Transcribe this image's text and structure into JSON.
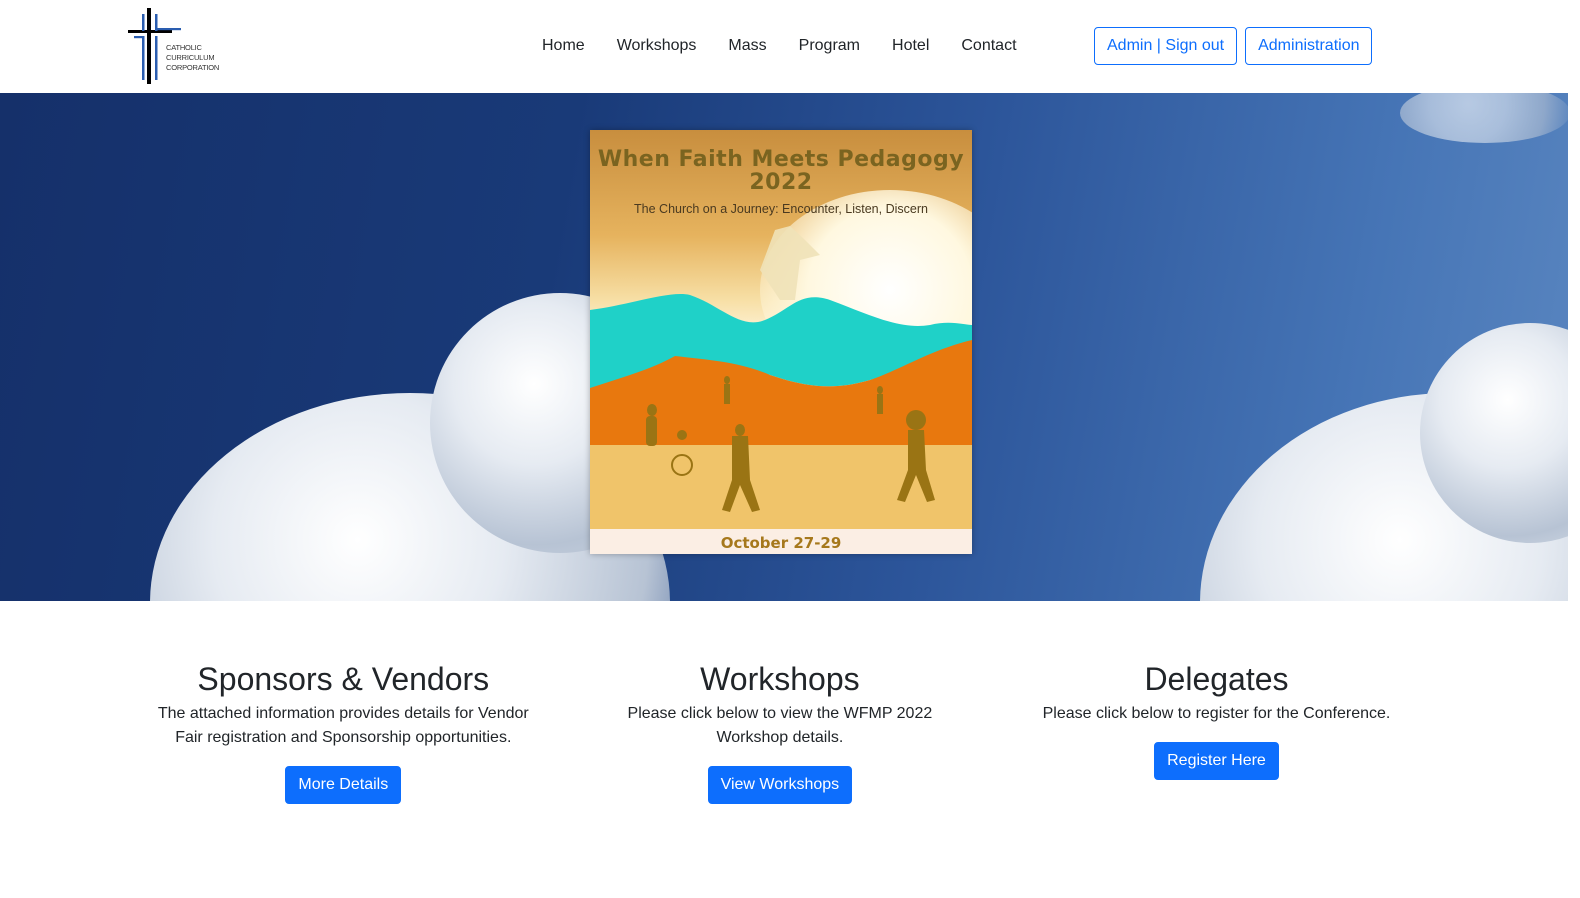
{
  "header": {
    "logo": {
      "line1": "CATHOLIC",
      "line2": "CURRICULUM",
      "line3": "CORPORATION"
    },
    "nav": [
      {
        "label": "Home"
      },
      {
        "label": "Workshops"
      },
      {
        "label": "Mass"
      },
      {
        "label": "Program"
      },
      {
        "label": "Hotel"
      },
      {
        "label": "Contact"
      }
    ],
    "buttons": {
      "admin_signout": "Admin | Sign out",
      "administration": "Administration"
    }
  },
  "hero": {
    "poster": {
      "title_line1": "When Faith Meets Pedagogy",
      "title_line2": "2022",
      "subtitle": "The Church on a Journey: Encounter, Listen, Discern",
      "date": "October 27-29"
    }
  },
  "cards": [
    {
      "title": "Sponsors & Vendors",
      "text": "The attached information provides details for Vendor Fair registration and Sponsorship opportunities.",
      "button": "More Details"
    },
    {
      "title": "Workshops",
      "text": "Please click below to view the WFMP 2022 Workshop details.",
      "button": "View Workshops"
    },
    {
      "title": "Delegates",
      "text": "Please click below to register for the Conference.",
      "button": "Register Here"
    }
  ],
  "colors": {
    "primary": "#0d6efd",
    "text": "#212529",
    "sky": "#193a78"
  }
}
